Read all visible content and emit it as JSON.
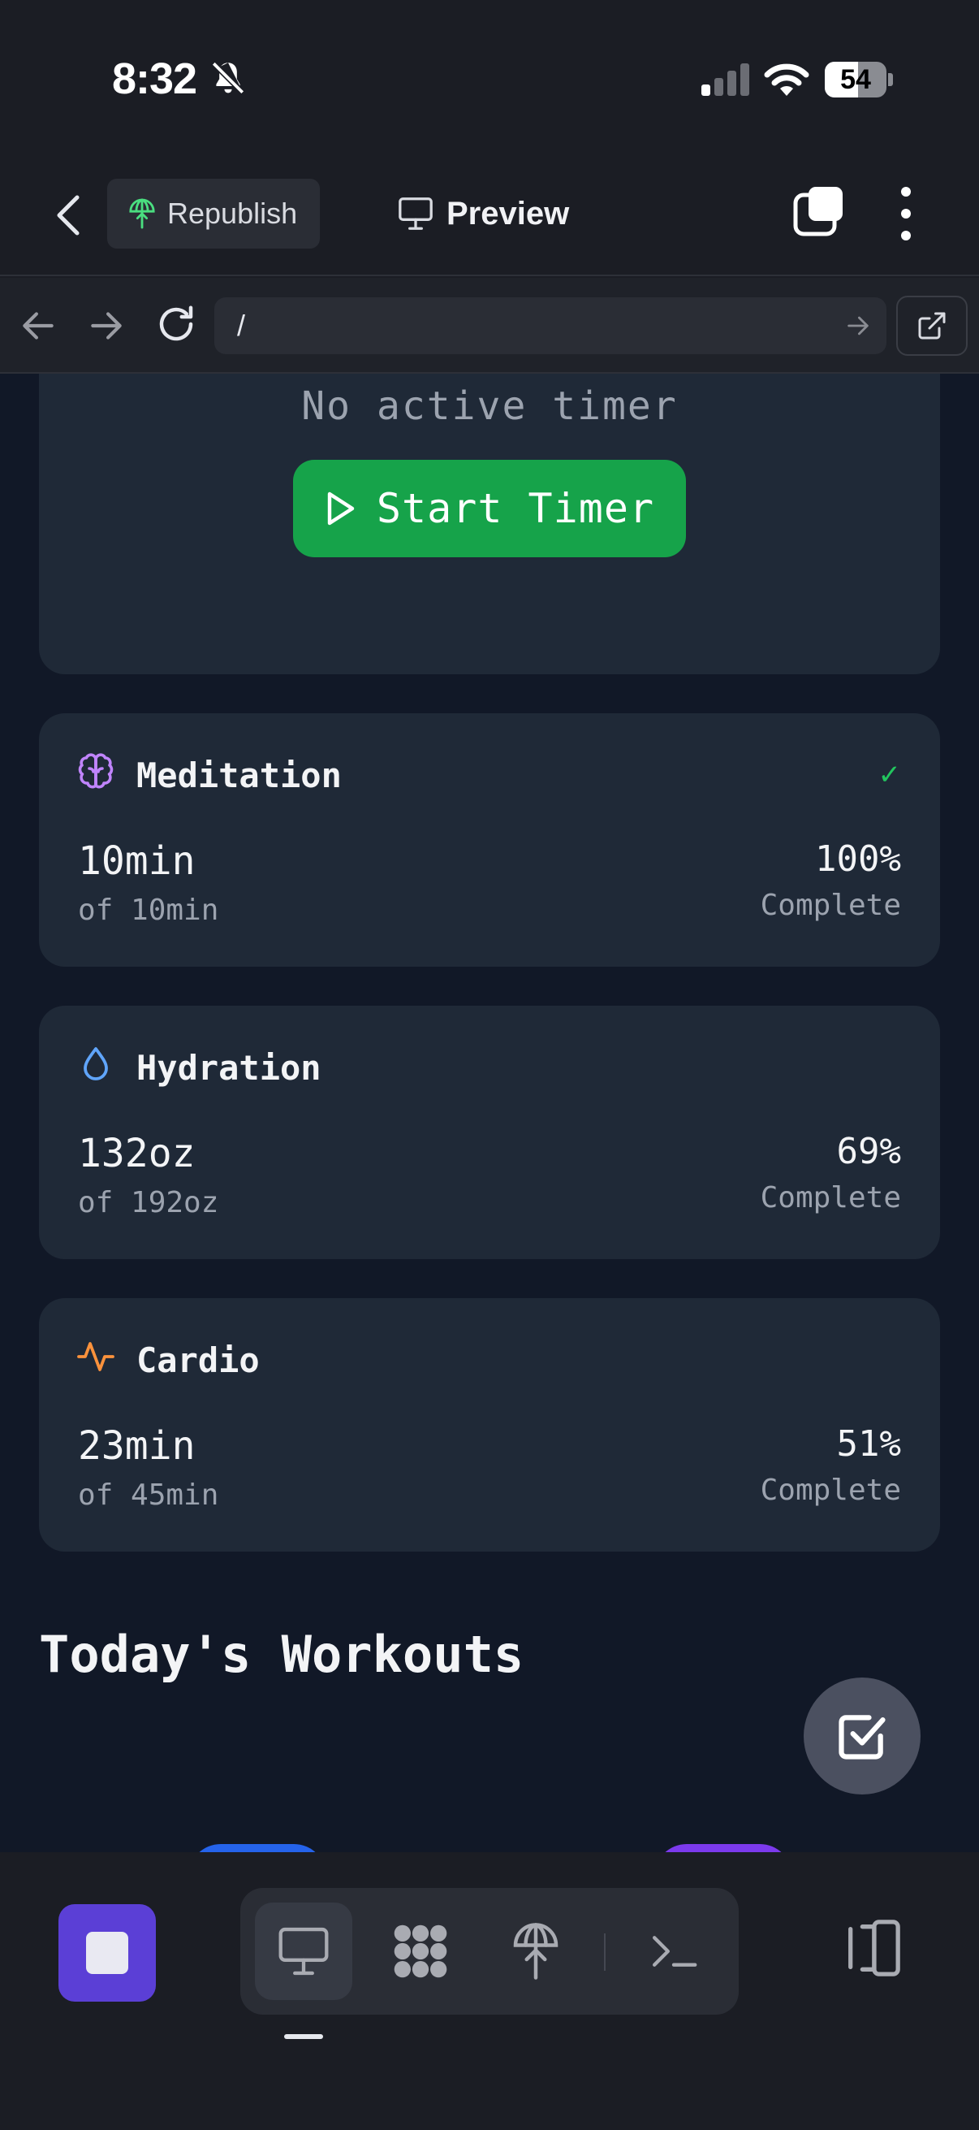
{
  "status_bar": {
    "time": "8:32",
    "battery": "54",
    "battery_level": 0.54
  },
  "header": {
    "republish_label": "Republish",
    "preview_label": "Preview"
  },
  "browser": {
    "url": "/"
  },
  "timer": {
    "status": "No active timer",
    "start_label": "Start Timer"
  },
  "goals": [
    {
      "icon": "brain-icon",
      "title": "Meditation",
      "value": "10min",
      "target": "of 10min",
      "percent": "100%",
      "complete_label": "Complete",
      "completed": true,
      "icon_color": "#c084fc"
    },
    {
      "icon": "droplet-icon",
      "title": "Hydration",
      "value": "132oz",
      "target": "of 192oz",
      "percent": "69%",
      "complete_label": "Complete",
      "completed": false,
      "icon_color": "#60a5fa"
    },
    {
      "icon": "activity-icon",
      "title": "Cardio",
      "value": "23min",
      "target": "of 45min",
      "percent": "51%",
      "complete_label": "Complete",
      "completed": false,
      "icon_color": "#fb923c"
    }
  ],
  "section": {
    "title": "Today's Workouts"
  },
  "check_mark": "✓",
  "colors": {
    "accent_green": "#16a34a",
    "stop_purple": "#5b3fd6",
    "card_bg": "#1f2937",
    "page_bg": "#111827"
  }
}
